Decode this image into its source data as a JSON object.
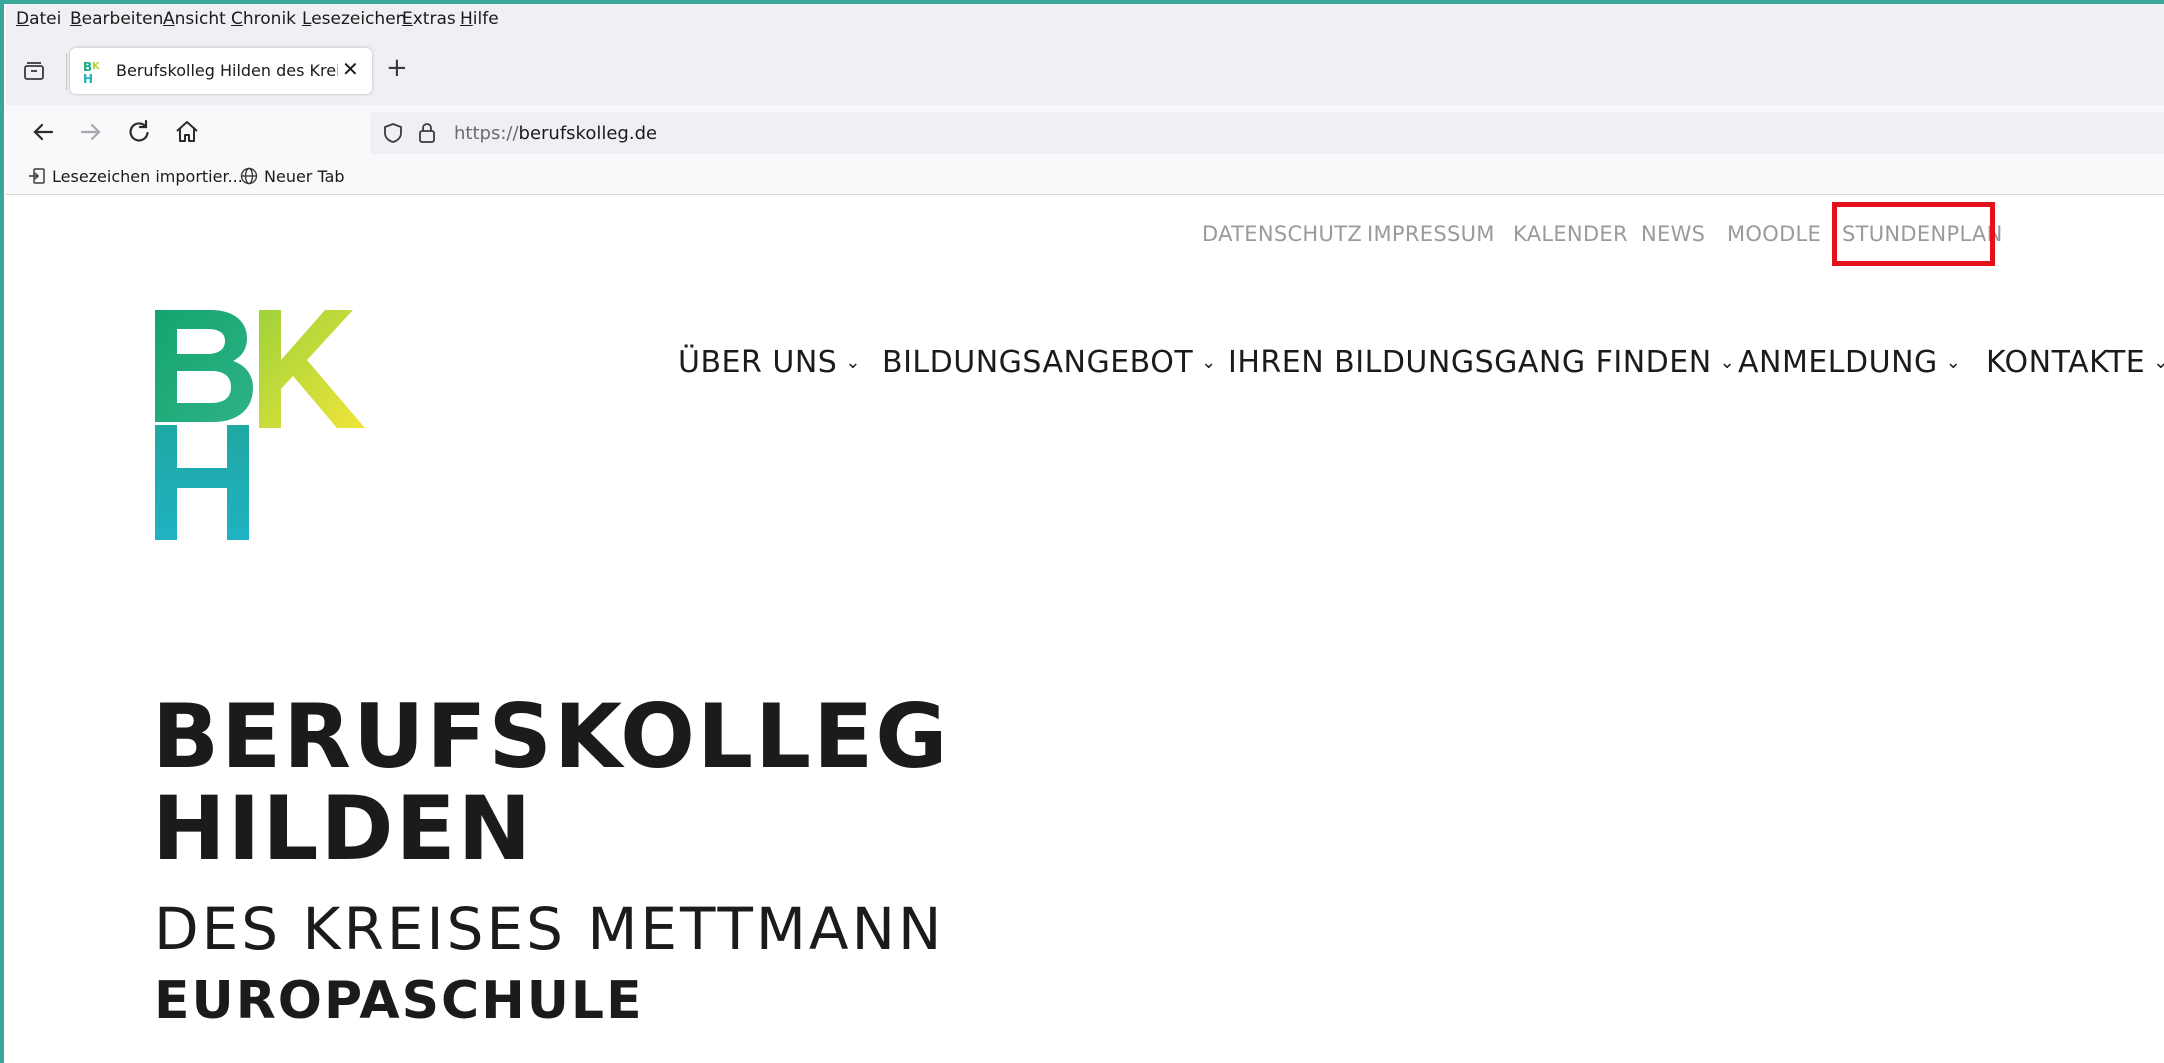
{
  "menubar": {
    "items": [
      "Datei",
      "Bearbeiten",
      "Ansicht",
      "Chronik",
      "Lesezeichen",
      "Extras",
      "Hilfe"
    ]
  },
  "tabs": [
    {
      "title": "Berufskolleg Hilden des Kreises Mettmann",
      "icon": "bkh-favicon"
    }
  ],
  "urlbar": {
    "protocol": "https://",
    "host": "berufskolleg.de"
  },
  "bookmarks": [
    {
      "label": "Lesezeichen importier...",
      "icon": "import-icon"
    },
    {
      "label": "Neuer Tab",
      "icon": "globe-icon"
    }
  ],
  "site": {
    "top_nav": [
      "DATENSCHUTZ",
      "IMPRESSUM",
      "KALENDER",
      "NEWS",
      "MOODLE",
      "STUNDENPLAN"
    ],
    "main_nav": [
      "ÜBER UNS",
      "BILDUNGSANGEBOT",
      "IHREN BILDUNGSGANG FINDEN",
      "ANMELDUNG",
      "KONTAKTE"
    ],
    "logo_letters": "BKH",
    "hero": {
      "line1": "BERUFSKOLLEG",
      "line2": "HILDEN",
      "subtitle": "DES KREISES METTMANN",
      "tagline": "EUROPASCHULE"
    },
    "highlight_color": "#e4101c"
  },
  "colors": {
    "frame_accent": "#3aa79a",
    "topnav_text": "#9a9a9a",
    "main_text": "#1b1b1b"
  }
}
